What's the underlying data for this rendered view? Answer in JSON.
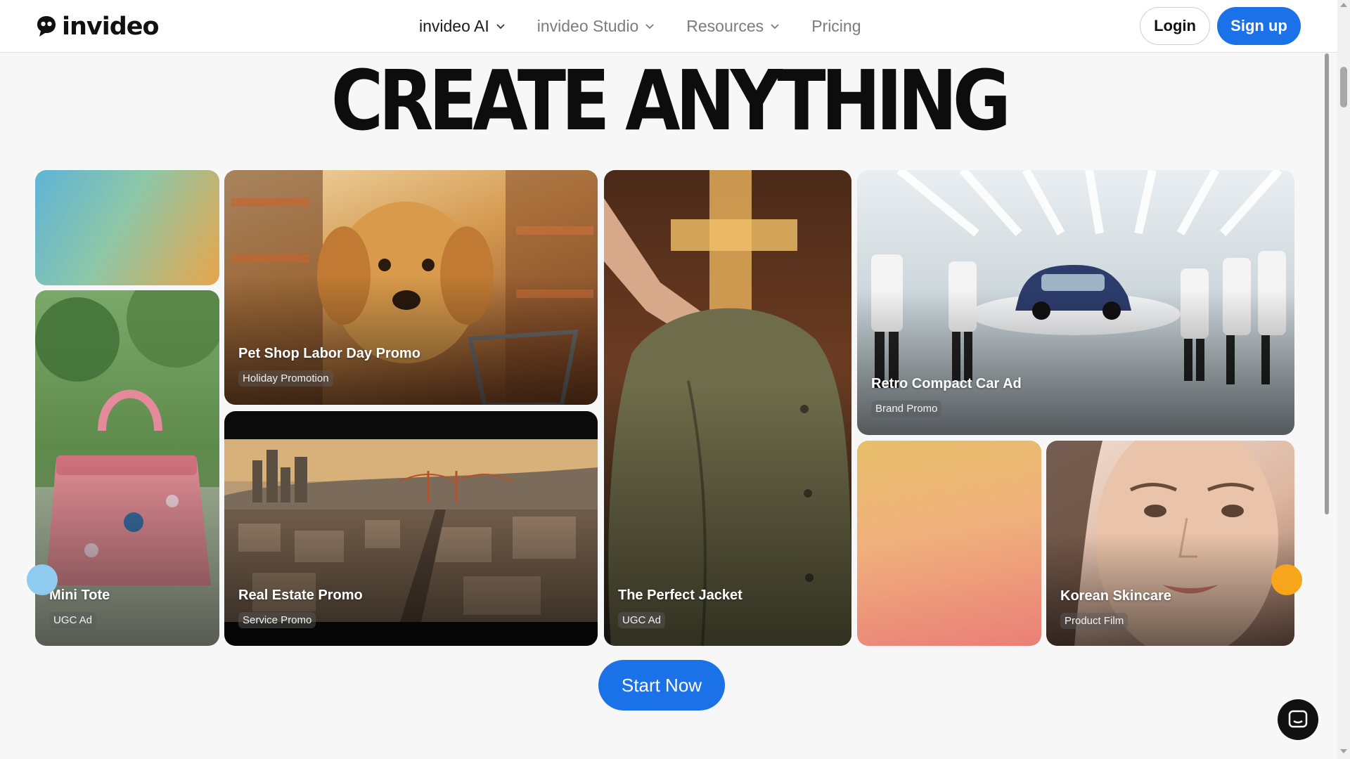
{
  "brand": {
    "name": "invideo",
    "logo_icon": "face-logo-icon"
  },
  "nav": {
    "items": [
      {
        "label": "invideo AI",
        "has_dropdown": true,
        "active": true
      },
      {
        "label": "invideo Studio",
        "has_dropdown": true,
        "active": false
      },
      {
        "label": "Resources",
        "has_dropdown": true,
        "active": false
      },
      {
        "label": "Pricing",
        "has_dropdown": false,
        "active": false
      }
    ],
    "login_label": "Login",
    "signup_label": "Sign up"
  },
  "hero": {
    "headline": "CREATE ANYTHING"
  },
  "cards": [
    {
      "title": "",
      "tag": "",
      "kind": "gradient-blue-orange"
    },
    {
      "title": "Pet Shop Labor Day Promo",
      "tag": "Holiday Promotion"
    },
    {
      "title": "The Perfect Jacket",
      "tag": "UGC Ad"
    },
    {
      "title": "Retro Compact Car Ad",
      "tag": "Brand Promo"
    },
    {
      "title": "Mini Tote",
      "tag": "UGC Ad"
    },
    {
      "title": "Real Estate Promo",
      "tag": "Service Promo"
    },
    {
      "title": "",
      "tag": "",
      "kind": "gradient-peach"
    },
    {
      "title": "Korean Skincare",
      "tag": "Product Film"
    }
  ],
  "cta": {
    "label": "Start Now"
  },
  "chat": {
    "icon": "chat-bubble-icon"
  },
  "colors": {
    "accent": "#1b72e8",
    "dot_left": "#8ecbee",
    "dot_right": "#f7a51a"
  }
}
